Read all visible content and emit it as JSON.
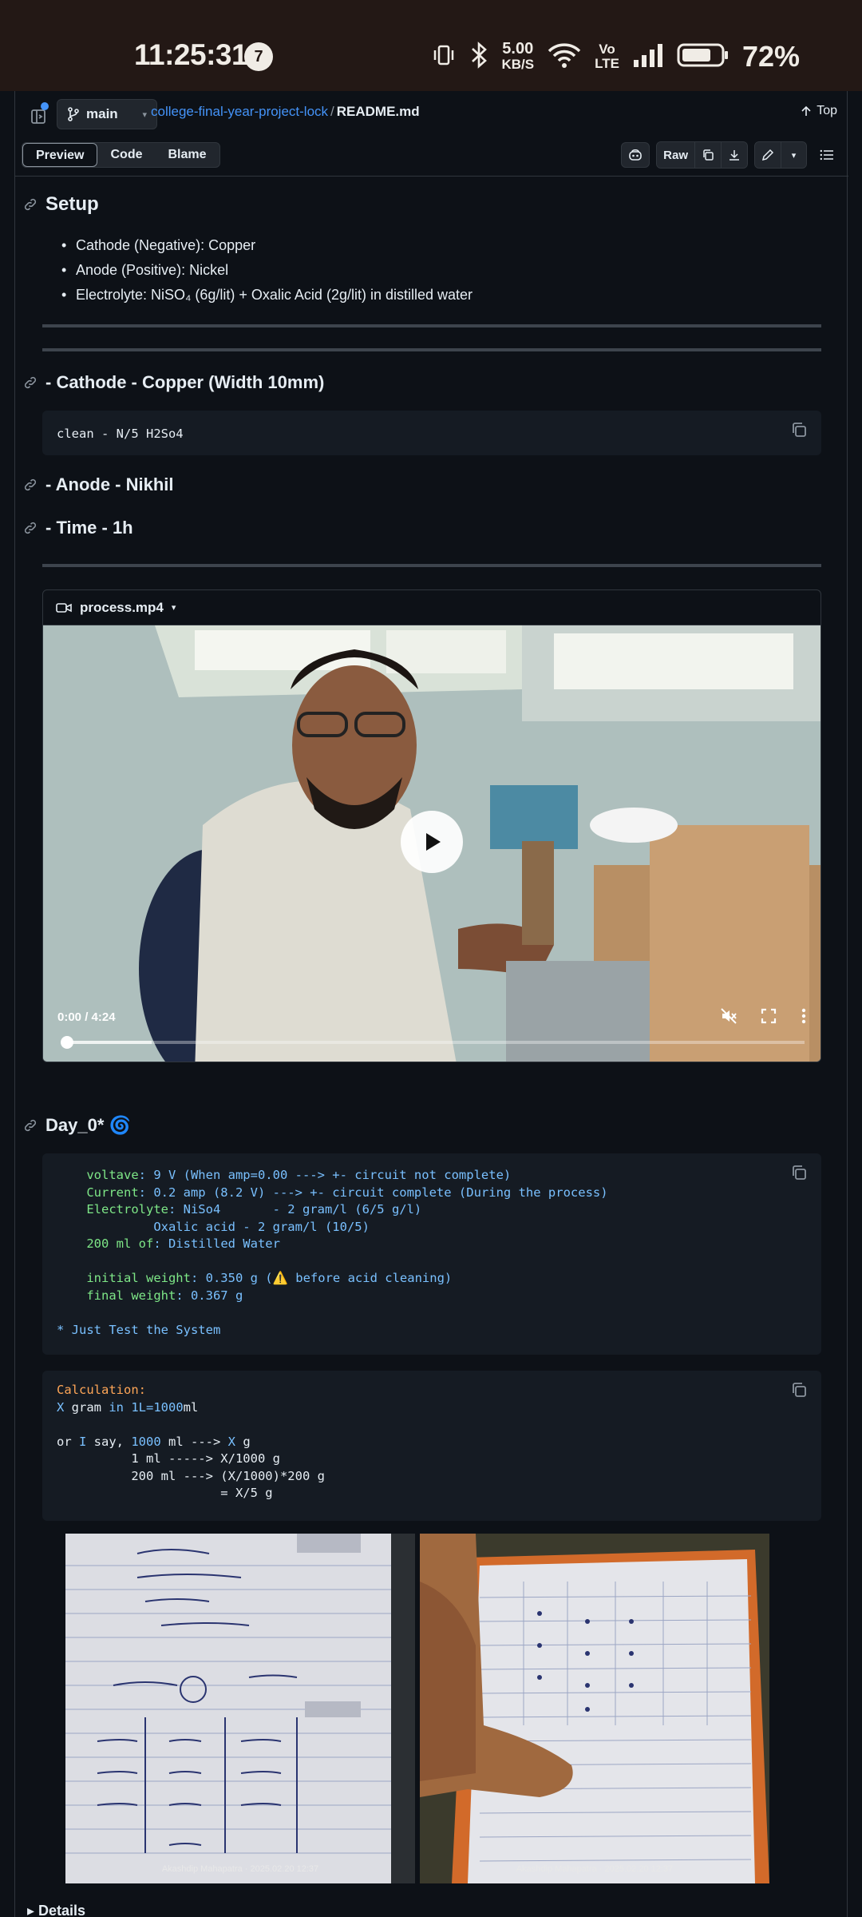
{
  "status_bar": {
    "time": "11:25:31",
    "notification_count": "7",
    "net_speed_value": "5.00",
    "net_speed_unit": "KB/S",
    "volte_top": "Vo",
    "volte_bottom": "LTE",
    "battery": "72%"
  },
  "header": {
    "branch": "main",
    "repo": "college-final-year-project-lock",
    "separator": "/",
    "file": "README.md",
    "top_link": "Top",
    "tabs": [
      "Preview",
      "Code",
      "Blame"
    ],
    "active_tab": "Preview",
    "raw_label": "Raw"
  },
  "readme": {
    "setup_heading": "Setup",
    "setup_items": [
      "Cathode (Negative): Copper",
      "Anode (Positive): Nickel",
      "Electrolyte: NiSO₄ (6g/lit) + Oxalic Acid (2g/lit) in distilled water"
    ],
    "cathode_heading": "- Cathode - Copper (Width 10mm)",
    "cathode_code": "clean - N/5 H2So4",
    "anode_heading": "- Anode - Nikhil",
    "time_heading": "- Time - 1h",
    "video": {
      "filename": "process.mp4",
      "time": "0:00 / 4:24",
      "progress_fraction": 0
    },
    "day_heading": "Day_0* 🌀",
    "day_code": {
      "voltave_key": "voltave",
      "voltave_val": ": 9 V (When amp=0.00 ---> +- circuit not complete)",
      "current_key": "Current",
      "current_val": ": 0.2 amp (8.2 V) ---> +- circuit complete (During the process)",
      "electrolyte_key": "Electrolyte",
      "electrolyte_val": ": NiSo4       - 2 gram/l (6/5 g/l)",
      "oxalic_line": "             Oxalic acid - 2 gram/l (10/5)",
      "water_key": "200 ml of",
      "water_val": ": Distilled Water",
      "initial_key": "initial weight",
      "initial_val": ": 0.350 g (⚠️ before acid cleaning)",
      "final_key": "final weight",
      "final_val": ": 0.367 g",
      "note": "* Just Test the System"
    },
    "calc_code": {
      "l1": "Calculation:",
      "l2_a": "X",
      "l2_b": " gram ",
      "l2_c": "in",
      "l2_d": " 1L=1000",
      "l2_e": "ml",
      "l3_a": "or ",
      "l3_b": "I",
      "l3_c": " say, ",
      "l3_d": "1000",
      "l3_e": " ml ---> ",
      "l3_f": "X",
      "l3_g": " g",
      "l4": "          1 ml -----> X/1000 g",
      "l5": "          200 ml ---> (X/1000)*200 g",
      "l6": "                      = X/5 g"
    },
    "photo_captions": [
      "Akashdip Mahapatra · 2025.02.20 12:37",
      "Akashdip Mahapatra · 2025.02.20 12:37"
    ],
    "details_label": "▸ Details"
  },
  "colors": {
    "background": "#0d1117",
    "accent_link": "#4493f8",
    "code_key_green": "#7ee787",
    "code_value_blue": "#79c0ff",
    "code_orange": "#ffa657"
  }
}
